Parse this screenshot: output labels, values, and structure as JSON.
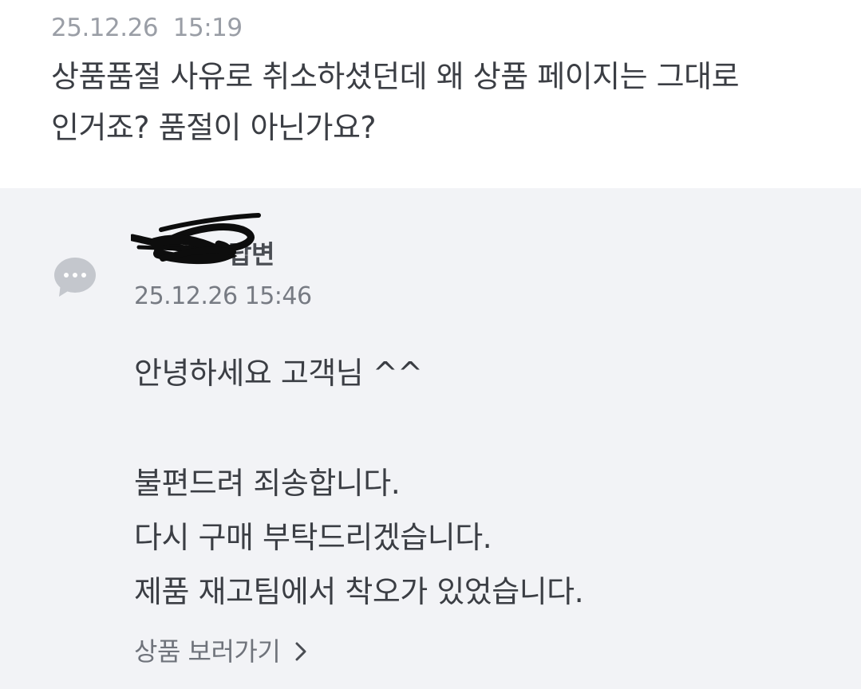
{
  "question": {
    "date": "25.12.26  15:19",
    "text_line1": "상품품절 사유로 취소하셨던데 왜 상품 페이지는 그대로",
    "text_line2": "인거죠? 품절이 아닌가요?"
  },
  "answer": {
    "icon": "chat-bubble-icon",
    "author_suffix": "답변",
    "date": "25.12.26 15:46",
    "lines": [
      "안녕하세요 고객님 ^^",
      "",
      "불편드려 죄송합니다.",
      "다시 구매 부탁드리겠습니다.",
      "제품 재고팀에서 착오가 있었습니다."
    ],
    "link_label": "상품 보러가기"
  },
  "colors": {
    "answer_bg": "#f2f3f6",
    "text": "#3b3e44",
    "muted": "#9a9ea6",
    "icon": "#c4c7cd"
  }
}
